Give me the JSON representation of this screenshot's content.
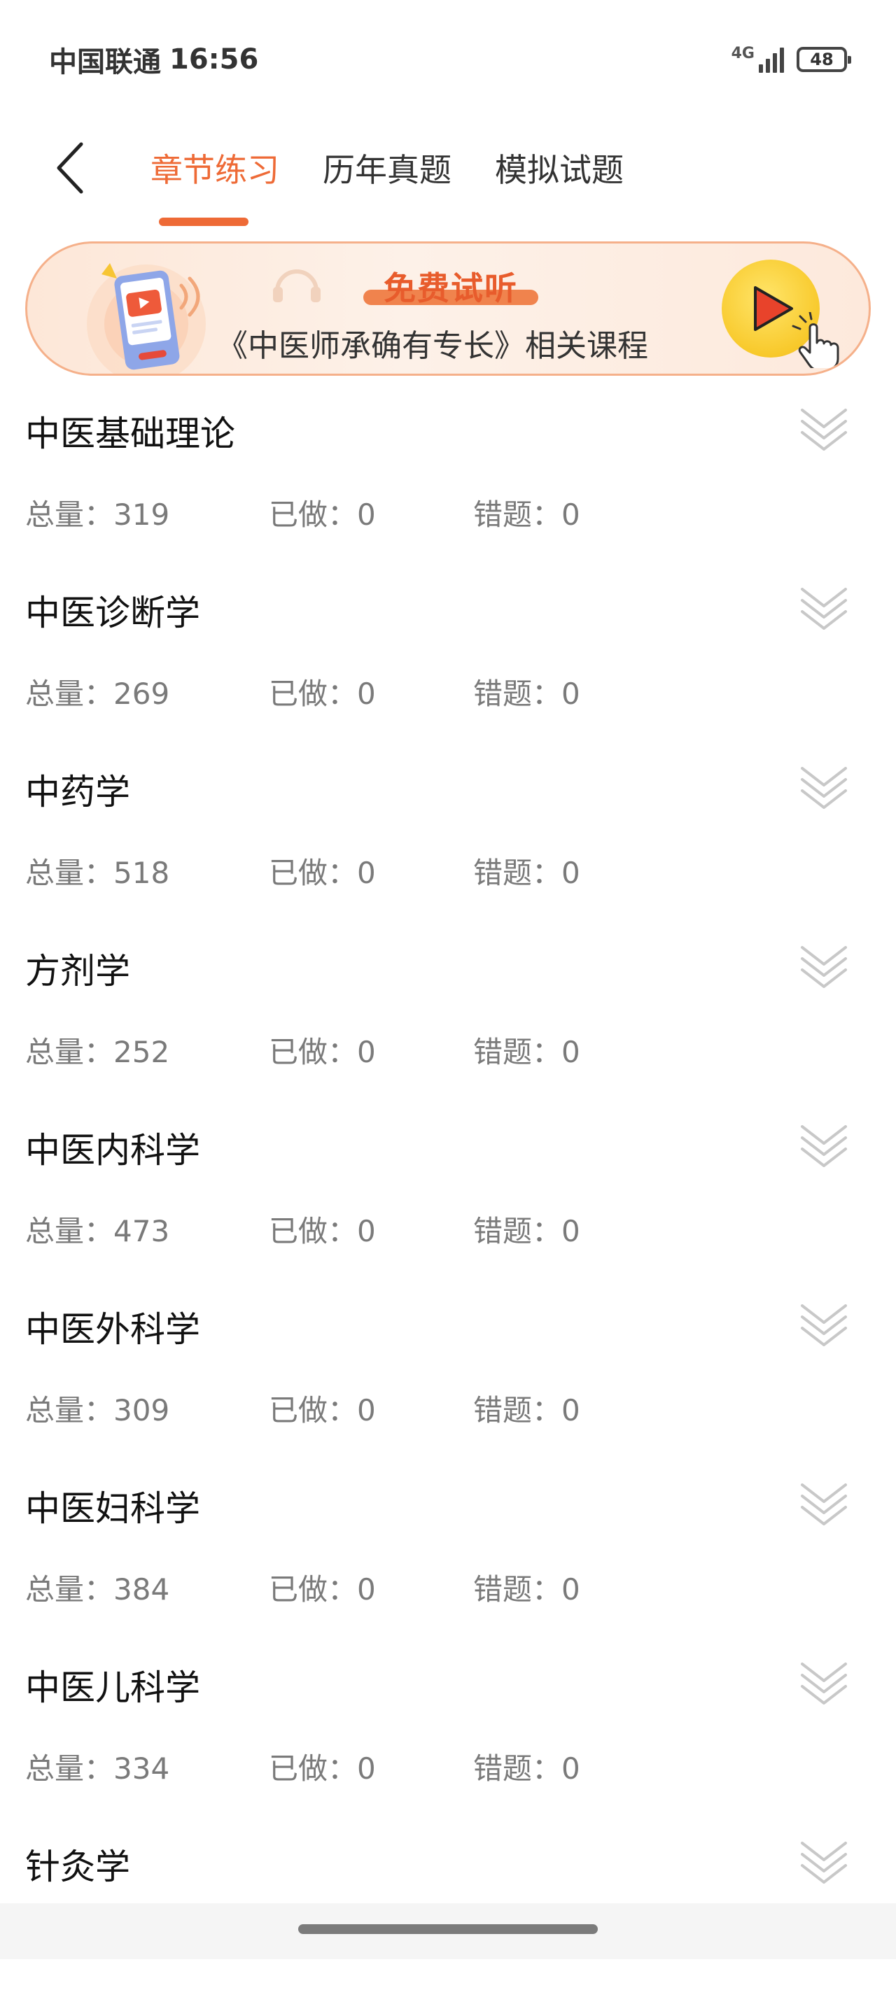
{
  "status_bar": {
    "carrier": "中国联通",
    "time": "16:56",
    "network": "4G",
    "battery": "48"
  },
  "header": {
    "tabs": [
      {
        "label": "章节练习",
        "active": true
      },
      {
        "label": "历年真题",
        "active": false
      },
      {
        "label": "模拟试题",
        "active": false
      }
    ]
  },
  "banner": {
    "tag": "免费试听",
    "subtitle": "《中医师承确有专长》相关课程"
  },
  "labels": {
    "total": "总量：",
    "done": "已做：",
    "wrong": "错题："
  },
  "chapters": [
    {
      "title": "中医基础理论",
      "total": "319",
      "done": "0",
      "wrong": "0"
    },
    {
      "title": "中医诊断学",
      "total": "269",
      "done": "0",
      "wrong": "0"
    },
    {
      "title": "中药学",
      "total": "518",
      "done": "0",
      "wrong": "0"
    },
    {
      "title": "方剂学",
      "total": "252",
      "done": "0",
      "wrong": "0"
    },
    {
      "title": "中医内科学",
      "total": "473",
      "done": "0",
      "wrong": "0"
    },
    {
      "title": "中医外科学",
      "total": "309",
      "done": "0",
      "wrong": "0"
    },
    {
      "title": "中医妇科学",
      "total": "384",
      "done": "0",
      "wrong": "0"
    },
    {
      "title": "中医儿科学",
      "total": "334",
      "done": "0",
      "wrong": "0"
    },
    {
      "title": "针灸学",
      "total": "",
      "done": "",
      "wrong": ""
    }
  ],
  "colors": {
    "accent": "#ee6a36",
    "stat_text": "#7a7a7a",
    "play_button": "#f8c92b"
  }
}
